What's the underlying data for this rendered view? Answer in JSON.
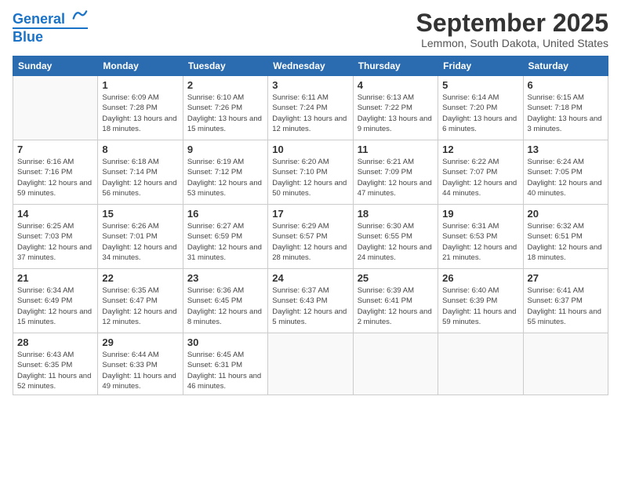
{
  "header": {
    "logo_line1": "General",
    "logo_line2": "Blue",
    "month": "September 2025",
    "location": "Lemmon, South Dakota, United States"
  },
  "weekdays": [
    "Sunday",
    "Monday",
    "Tuesday",
    "Wednesday",
    "Thursday",
    "Friday",
    "Saturday"
  ],
  "weeks": [
    [
      {
        "day": null
      },
      {
        "day": "1",
        "sunrise": "6:09 AM",
        "sunset": "7:28 PM",
        "daylight": "13 hours and 18 minutes."
      },
      {
        "day": "2",
        "sunrise": "6:10 AM",
        "sunset": "7:26 PM",
        "daylight": "13 hours and 15 minutes."
      },
      {
        "day": "3",
        "sunrise": "6:11 AM",
        "sunset": "7:24 PM",
        "daylight": "13 hours and 12 minutes."
      },
      {
        "day": "4",
        "sunrise": "6:13 AM",
        "sunset": "7:22 PM",
        "daylight": "13 hours and 9 minutes."
      },
      {
        "day": "5",
        "sunrise": "6:14 AM",
        "sunset": "7:20 PM",
        "daylight": "13 hours and 6 minutes."
      },
      {
        "day": "6",
        "sunrise": "6:15 AM",
        "sunset": "7:18 PM",
        "daylight": "13 hours and 3 minutes."
      }
    ],
    [
      {
        "day": "7",
        "sunrise": "6:16 AM",
        "sunset": "7:16 PM",
        "daylight": "12 hours and 59 minutes."
      },
      {
        "day": "8",
        "sunrise": "6:18 AM",
        "sunset": "7:14 PM",
        "daylight": "12 hours and 56 minutes."
      },
      {
        "day": "9",
        "sunrise": "6:19 AM",
        "sunset": "7:12 PM",
        "daylight": "12 hours and 53 minutes."
      },
      {
        "day": "10",
        "sunrise": "6:20 AM",
        "sunset": "7:10 PM",
        "daylight": "12 hours and 50 minutes."
      },
      {
        "day": "11",
        "sunrise": "6:21 AM",
        "sunset": "7:09 PM",
        "daylight": "12 hours and 47 minutes."
      },
      {
        "day": "12",
        "sunrise": "6:22 AM",
        "sunset": "7:07 PM",
        "daylight": "12 hours and 44 minutes."
      },
      {
        "day": "13",
        "sunrise": "6:24 AM",
        "sunset": "7:05 PM",
        "daylight": "12 hours and 40 minutes."
      }
    ],
    [
      {
        "day": "14",
        "sunrise": "6:25 AM",
        "sunset": "7:03 PM",
        "daylight": "12 hours and 37 minutes."
      },
      {
        "day": "15",
        "sunrise": "6:26 AM",
        "sunset": "7:01 PM",
        "daylight": "12 hours and 34 minutes."
      },
      {
        "day": "16",
        "sunrise": "6:27 AM",
        "sunset": "6:59 PM",
        "daylight": "12 hours and 31 minutes."
      },
      {
        "day": "17",
        "sunrise": "6:29 AM",
        "sunset": "6:57 PM",
        "daylight": "12 hours and 28 minutes."
      },
      {
        "day": "18",
        "sunrise": "6:30 AM",
        "sunset": "6:55 PM",
        "daylight": "12 hours and 24 minutes."
      },
      {
        "day": "19",
        "sunrise": "6:31 AM",
        "sunset": "6:53 PM",
        "daylight": "12 hours and 21 minutes."
      },
      {
        "day": "20",
        "sunrise": "6:32 AM",
        "sunset": "6:51 PM",
        "daylight": "12 hours and 18 minutes."
      }
    ],
    [
      {
        "day": "21",
        "sunrise": "6:34 AM",
        "sunset": "6:49 PM",
        "daylight": "12 hours and 15 minutes."
      },
      {
        "day": "22",
        "sunrise": "6:35 AM",
        "sunset": "6:47 PM",
        "daylight": "12 hours and 12 minutes."
      },
      {
        "day": "23",
        "sunrise": "6:36 AM",
        "sunset": "6:45 PM",
        "daylight": "12 hours and 8 minutes."
      },
      {
        "day": "24",
        "sunrise": "6:37 AM",
        "sunset": "6:43 PM",
        "daylight": "12 hours and 5 minutes."
      },
      {
        "day": "25",
        "sunrise": "6:39 AM",
        "sunset": "6:41 PM",
        "daylight": "12 hours and 2 minutes."
      },
      {
        "day": "26",
        "sunrise": "6:40 AM",
        "sunset": "6:39 PM",
        "daylight": "11 hours and 59 minutes."
      },
      {
        "day": "27",
        "sunrise": "6:41 AM",
        "sunset": "6:37 PM",
        "daylight": "11 hours and 55 minutes."
      }
    ],
    [
      {
        "day": "28",
        "sunrise": "6:43 AM",
        "sunset": "6:35 PM",
        "daylight": "11 hours and 52 minutes."
      },
      {
        "day": "29",
        "sunrise": "6:44 AM",
        "sunset": "6:33 PM",
        "daylight": "11 hours and 49 minutes."
      },
      {
        "day": "30",
        "sunrise": "6:45 AM",
        "sunset": "6:31 PM",
        "daylight": "11 hours and 46 minutes."
      },
      {
        "day": null
      },
      {
        "day": null
      },
      {
        "day": null
      },
      {
        "day": null
      }
    ]
  ]
}
